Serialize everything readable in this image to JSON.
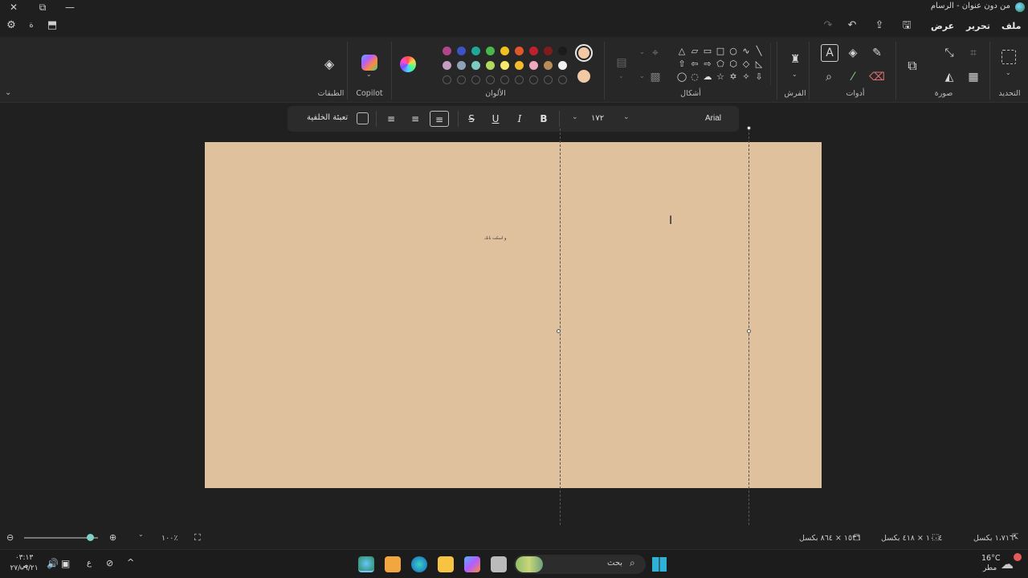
{
  "window": {
    "title": "من دون عنوان - الرسام",
    "close": "✕",
    "restore": "⧉",
    "minimize": "—"
  },
  "menu": {
    "file": "ملف",
    "edit": "تحرير",
    "view": "عرض"
  },
  "ribbon": {
    "groups": {
      "select": "التحديد",
      "image": "صورة",
      "tools": "أدوات",
      "brushes": "الفرش",
      "shapes": "أشكال",
      "colors": "الألوان",
      "copilot": "Copilot",
      "layers": "الطبقات"
    },
    "colors_row1": [
      "#1b1b1b",
      "#7f1d1d",
      "#c21f2e",
      "#e0582a",
      "#f0c01f",
      "#49b74a",
      "#1fa89a",
      "#3d52c4",
      "#b0458a"
    ],
    "colors_row2": [
      "#f1f1f1",
      "#b88b5a",
      "#f0a7c0",
      "#f4bb2b",
      "#f6e96b",
      "#b1d95c",
      "#7ec9c0",
      "#8fa3b8",
      "#c59ec4"
    ],
    "primary_color": "#f2c9a5",
    "secondary_color": "#f2c9a5"
  },
  "text_toolbar": {
    "font": "Arial",
    "size": "١٧٢",
    "bold": "B",
    "italic": "I",
    "underline": "U",
    "strike": "S",
    "fill_bg_label": "تعبئة الخلفية"
  },
  "canvas": {
    "text": "ﻭ ﺍﺳﻜﺖ ﺑﺎﻧﻚ",
    "color": "#e0c19e"
  },
  "status": {
    "cursor": "١،٧١٦٠ بكسل",
    "selection": "١٠٠٤ × ٤١٨ بكسل",
    "canvas_size": "١٥٣٦ × ٨٦٤ بكسل",
    "zoom": "١٠٠٪"
  },
  "taskbar": {
    "search_placeholder": "بحث",
    "weather_temp": "16°C",
    "weather_label": "مطر",
    "time": "٠٣:١٣ ص",
    "date": "٢٧/٠٩/٢١",
    "lang": "ع"
  }
}
